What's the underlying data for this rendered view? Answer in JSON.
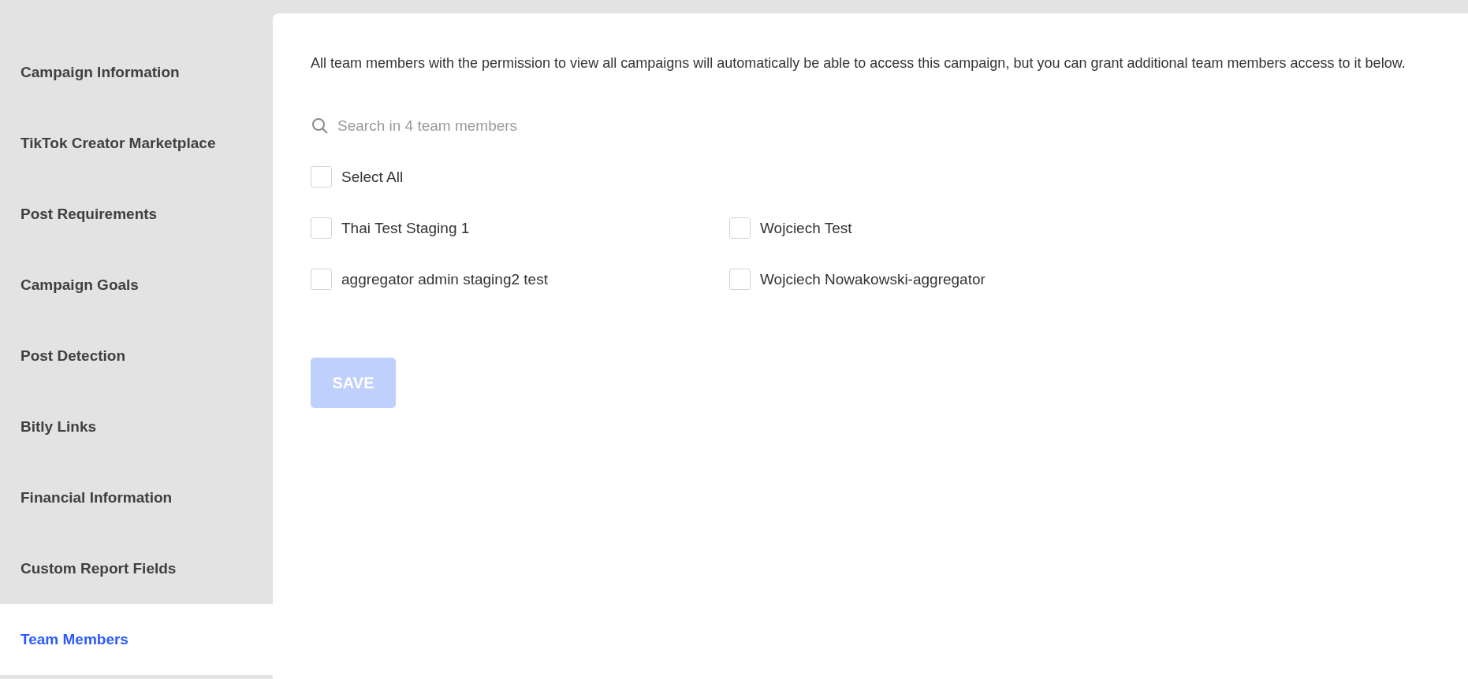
{
  "sidebar": {
    "items": [
      {
        "label": "Campaign Information",
        "selected": false
      },
      {
        "label": "TikTok Creator Marketplace",
        "selected": false
      },
      {
        "label": "Post Requirements",
        "selected": false
      },
      {
        "label": "Campaign Goals",
        "selected": false
      },
      {
        "label": "Post Detection",
        "selected": false
      },
      {
        "label": "Bitly Links",
        "selected": false
      },
      {
        "label": "Financial Information",
        "selected": false
      },
      {
        "label": "Custom Report Fields",
        "selected": false
      },
      {
        "label": "Team Members",
        "selected": true
      }
    ]
  },
  "description": "All team members with the permission to view all campaigns will automatically be able to access this campaign, but you can grant additional team members access to it below.",
  "search": {
    "placeholder": "Search in 4 team members"
  },
  "select_all": {
    "label": "Select All",
    "checked": false
  },
  "members": [
    {
      "name": "Thai Test Staging 1",
      "checked": false
    },
    {
      "name": "Wojciech Test",
      "checked": false
    },
    {
      "name": "aggregator admin staging2 test",
      "checked": false
    },
    {
      "name": "Wojciech Nowakowski-aggregator",
      "checked": false
    }
  ],
  "save_button": {
    "label": "SAVE",
    "disabled": true
  }
}
